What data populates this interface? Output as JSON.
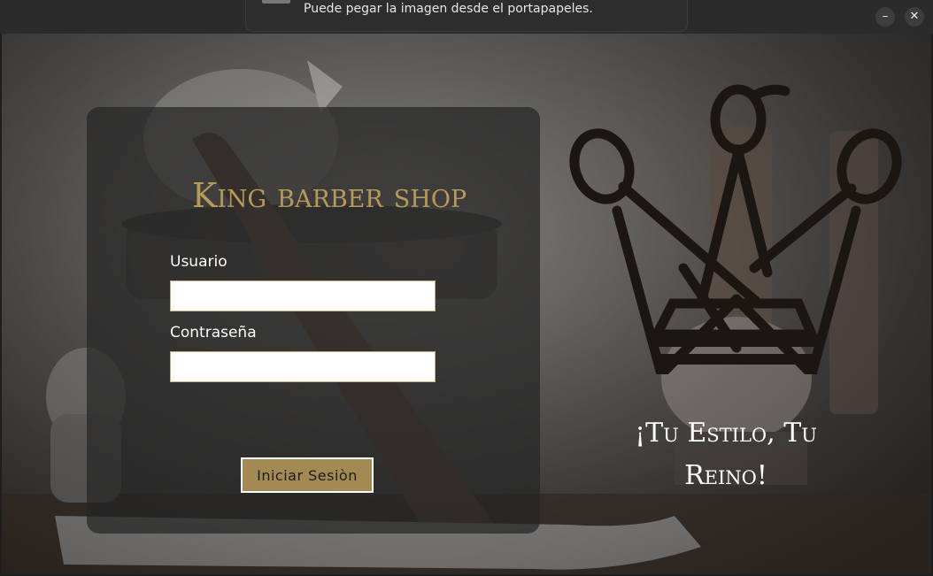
{
  "notification": {
    "text": "Puede pegar la imagen desde el portapapeles."
  },
  "window_controls": {
    "minimize": "–",
    "close": "✕"
  },
  "login": {
    "brand": "King barber shop",
    "username_label": "Usuario",
    "username_value": "",
    "password_label": "Contraseña",
    "password_value": "",
    "submit_label": "Iniciar  Sesiòn"
  },
  "slogan": "¡Tu Estilo, Tu Reino!",
  "colors": {
    "accent_gold": "#a28a52",
    "brand_gold": "#b79a5a",
    "logo_dark": "#1c1612",
    "panel": "#262626"
  },
  "icons": {
    "logo": "crown-scissors-logo",
    "close": "close-icon",
    "minimize": "minimize-icon"
  }
}
